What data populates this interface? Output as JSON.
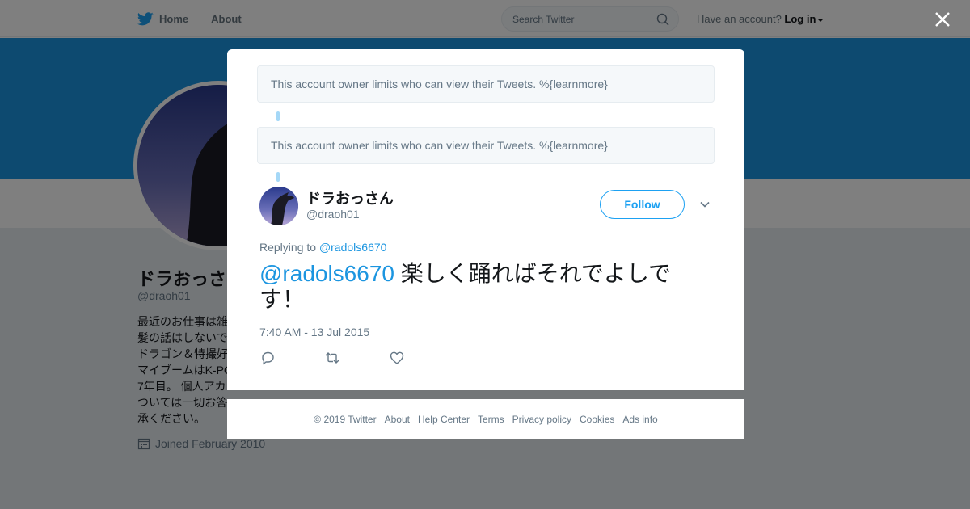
{
  "nav": {
    "home_label": "Home",
    "about_label": "About",
    "search_placeholder": "Search Twitter",
    "account_prompt": "Have an account?",
    "login_label": "Log in"
  },
  "profile": {
    "name": "ドラおっさ",
    "handle": "@draoh01",
    "bio_lines": [
      "最近のお仕事は雑",
      "髪の話はしないで",
      "ドラゴン＆特撮好",
      "マイブームはK-PC",
      "7年目。 個人アカ",
      "ついては一切お答",
      "承ください。"
    ],
    "joined": "Joined February 2010"
  },
  "modal": {
    "notice_1": "This account owner limits who can view their Tweets. %{learnmore}",
    "notice_2": "This account owner limits who can view their Tweets. %{learnmore}",
    "tweet": {
      "display_name": "ドラおっさん",
      "handle": "@draoh01",
      "follow_label": "Follow",
      "replying_prefix": "Replying to",
      "replying_to": "@radols6670",
      "text_mention": "@radols6670",
      "text_body": " 楽しく踊ればそれでよしです！",
      "timestamp": "7:40 AM - 13 Jul 2015"
    }
  },
  "footer": {
    "copyright": "© 2019 Twitter",
    "links": [
      "About",
      "Help Center",
      "Terms",
      "Privacy policy",
      "Cookies",
      "Ads info"
    ]
  },
  "colors": {
    "accent": "#1da1f2",
    "banner": "#1b95e0",
    "overlay": "rgba(0,0,0,0.5)"
  },
  "icons": [
    "twitter-bird-icon",
    "search-icon",
    "caret-down-icon",
    "close-icon",
    "chevron-down-icon",
    "reply-icon",
    "retweet-icon",
    "heart-icon",
    "calendar-icon"
  ]
}
